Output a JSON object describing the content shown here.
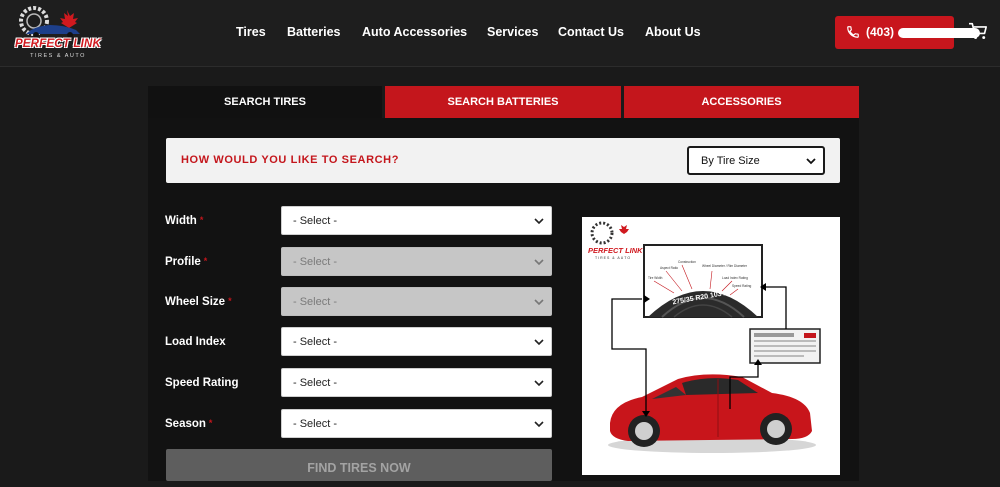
{
  "header": {
    "logo": {
      "brand": "PERFECT LINK",
      "tagline": "TIRES & AUTO"
    },
    "nav": [
      "Tires",
      "Batteries",
      "Auto Accessories",
      "Services",
      "Contact Us",
      "About Us"
    ],
    "phone": "(403)",
    "icons": {
      "phone": "phone-icon",
      "cart": "cart-icon"
    },
    "colors": {
      "accent": "#c8161d",
      "background": "#1e1e1e"
    }
  },
  "tabs": [
    "SEARCH TIRES",
    "SEARCH BATTERIES",
    "ACCESSORIES"
  ],
  "active_tab": "SEARCH TIRES",
  "search": {
    "question": "HOW WOULD YOU LIKE TO SEARCH?",
    "mode": "By Tire Size"
  },
  "fields": [
    {
      "label": "Width",
      "required": true,
      "value": "- Select -",
      "disabled": false
    },
    {
      "label": "Profile",
      "required": true,
      "value": "- Select -",
      "disabled": true
    },
    {
      "label": "Wheel Size",
      "required": true,
      "value": "- Select -",
      "disabled": true
    },
    {
      "label": "Load Index",
      "required": false,
      "value": "- Select -",
      "disabled": false
    },
    {
      "label": "Speed Rating",
      "required": false,
      "value": "- Select -",
      "disabled": false
    },
    {
      "label": "Season",
      "required": true,
      "value": "- Select -",
      "disabled": false
    }
  ],
  "required_mark": "*",
  "submit_label": "FIND TIRES NOW",
  "diagram": {
    "logo_brand": "PERFECT LINK",
    "logo_tagline": "TIRES & AUTO",
    "tire_size": "275/35 R20 103Y",
    "callouts": [
      "Construction",
      "Aspect Ratio",
      "Wheel Diameter / Rim Diameter",
      "Tire Width",
      "Load Index Rating",
      "Speed Rating"
    ]
  }
}
